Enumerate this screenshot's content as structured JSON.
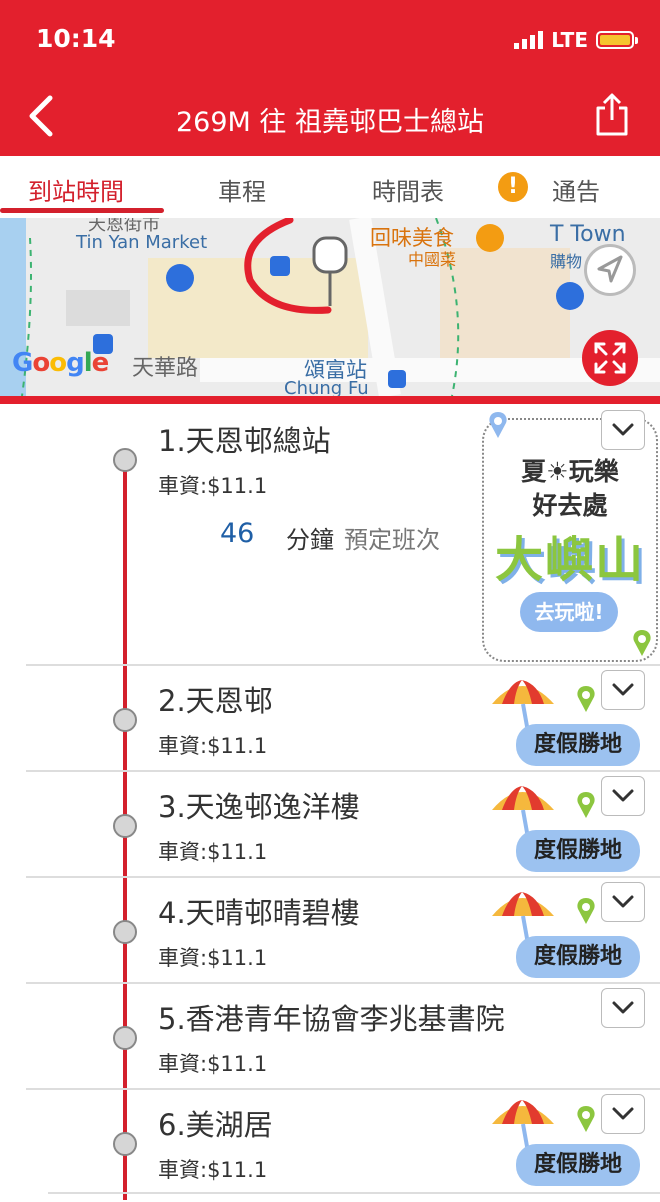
{
  "status": {
    "time": "10:14",
    "network": "LTE"
  },
  "header": {
    "title": "269M 往 祖堯邨巴士總站"
  },
  "tabs": [
    {
      "label": "到站時間",
      "active": true
    },
    {
      "label": "車程",
      "active": false
    },
    {
      "label": "時間表",
      "active": false
    },
    {
      "label": "通告",
      "active": false
    }
  ],
  "map": {
    "labels": {
      "tin_yan_market": "Tin Yan Market",
      "tin_yan_market_cn": "天恩街市",
      "restaurant": "回味美食",
      "restaurant_sub": "中國菜",
      "t_town": "T Town",
      "t_town_sub": "購物",
      "road": "天華路",
      "station_cn": "頌富站",
      "station_en": "Chung Fu",
      "google": "Google"
    }
  },
  "stops": [
    {
      "name": "1.天恩邨總站",
      "fare": "車資:$11.1"
    },
    {
      "name": "2.天恩邨",
      "fare": "車資:$11.1"
    },
    {
      "name": "3.天逸邨逸洋樓",
      "fare": "車資:$11.1"
    },
    {
      "name": "4.天晴邨晴碧樓",
      "fare": "車資:$11.1"
    },
    {
      "name": "5.香港青年協會李兆基書院",
      "fare": "車資:$11.1"
    },
    {
      "name": "6.美湖居",
      "fare": "車資:$11.1"
    }
  ],
  "eta": {
    "minutes": "46",
    "unit": "分鐘",
    "note": "預定班次"
  },
  "ad": {
    "line1": "夏☀玩樂",
    "line2": "好去處",
    "big": "大嶼山",
    "button": "去玩啦!"
  },
  "vacation_label": "度假勝地",
  "colors": {
    "primary": "#e3202d",
    "route": "#d3202c",
    "eta": "#1f5fa6"
  }
}
